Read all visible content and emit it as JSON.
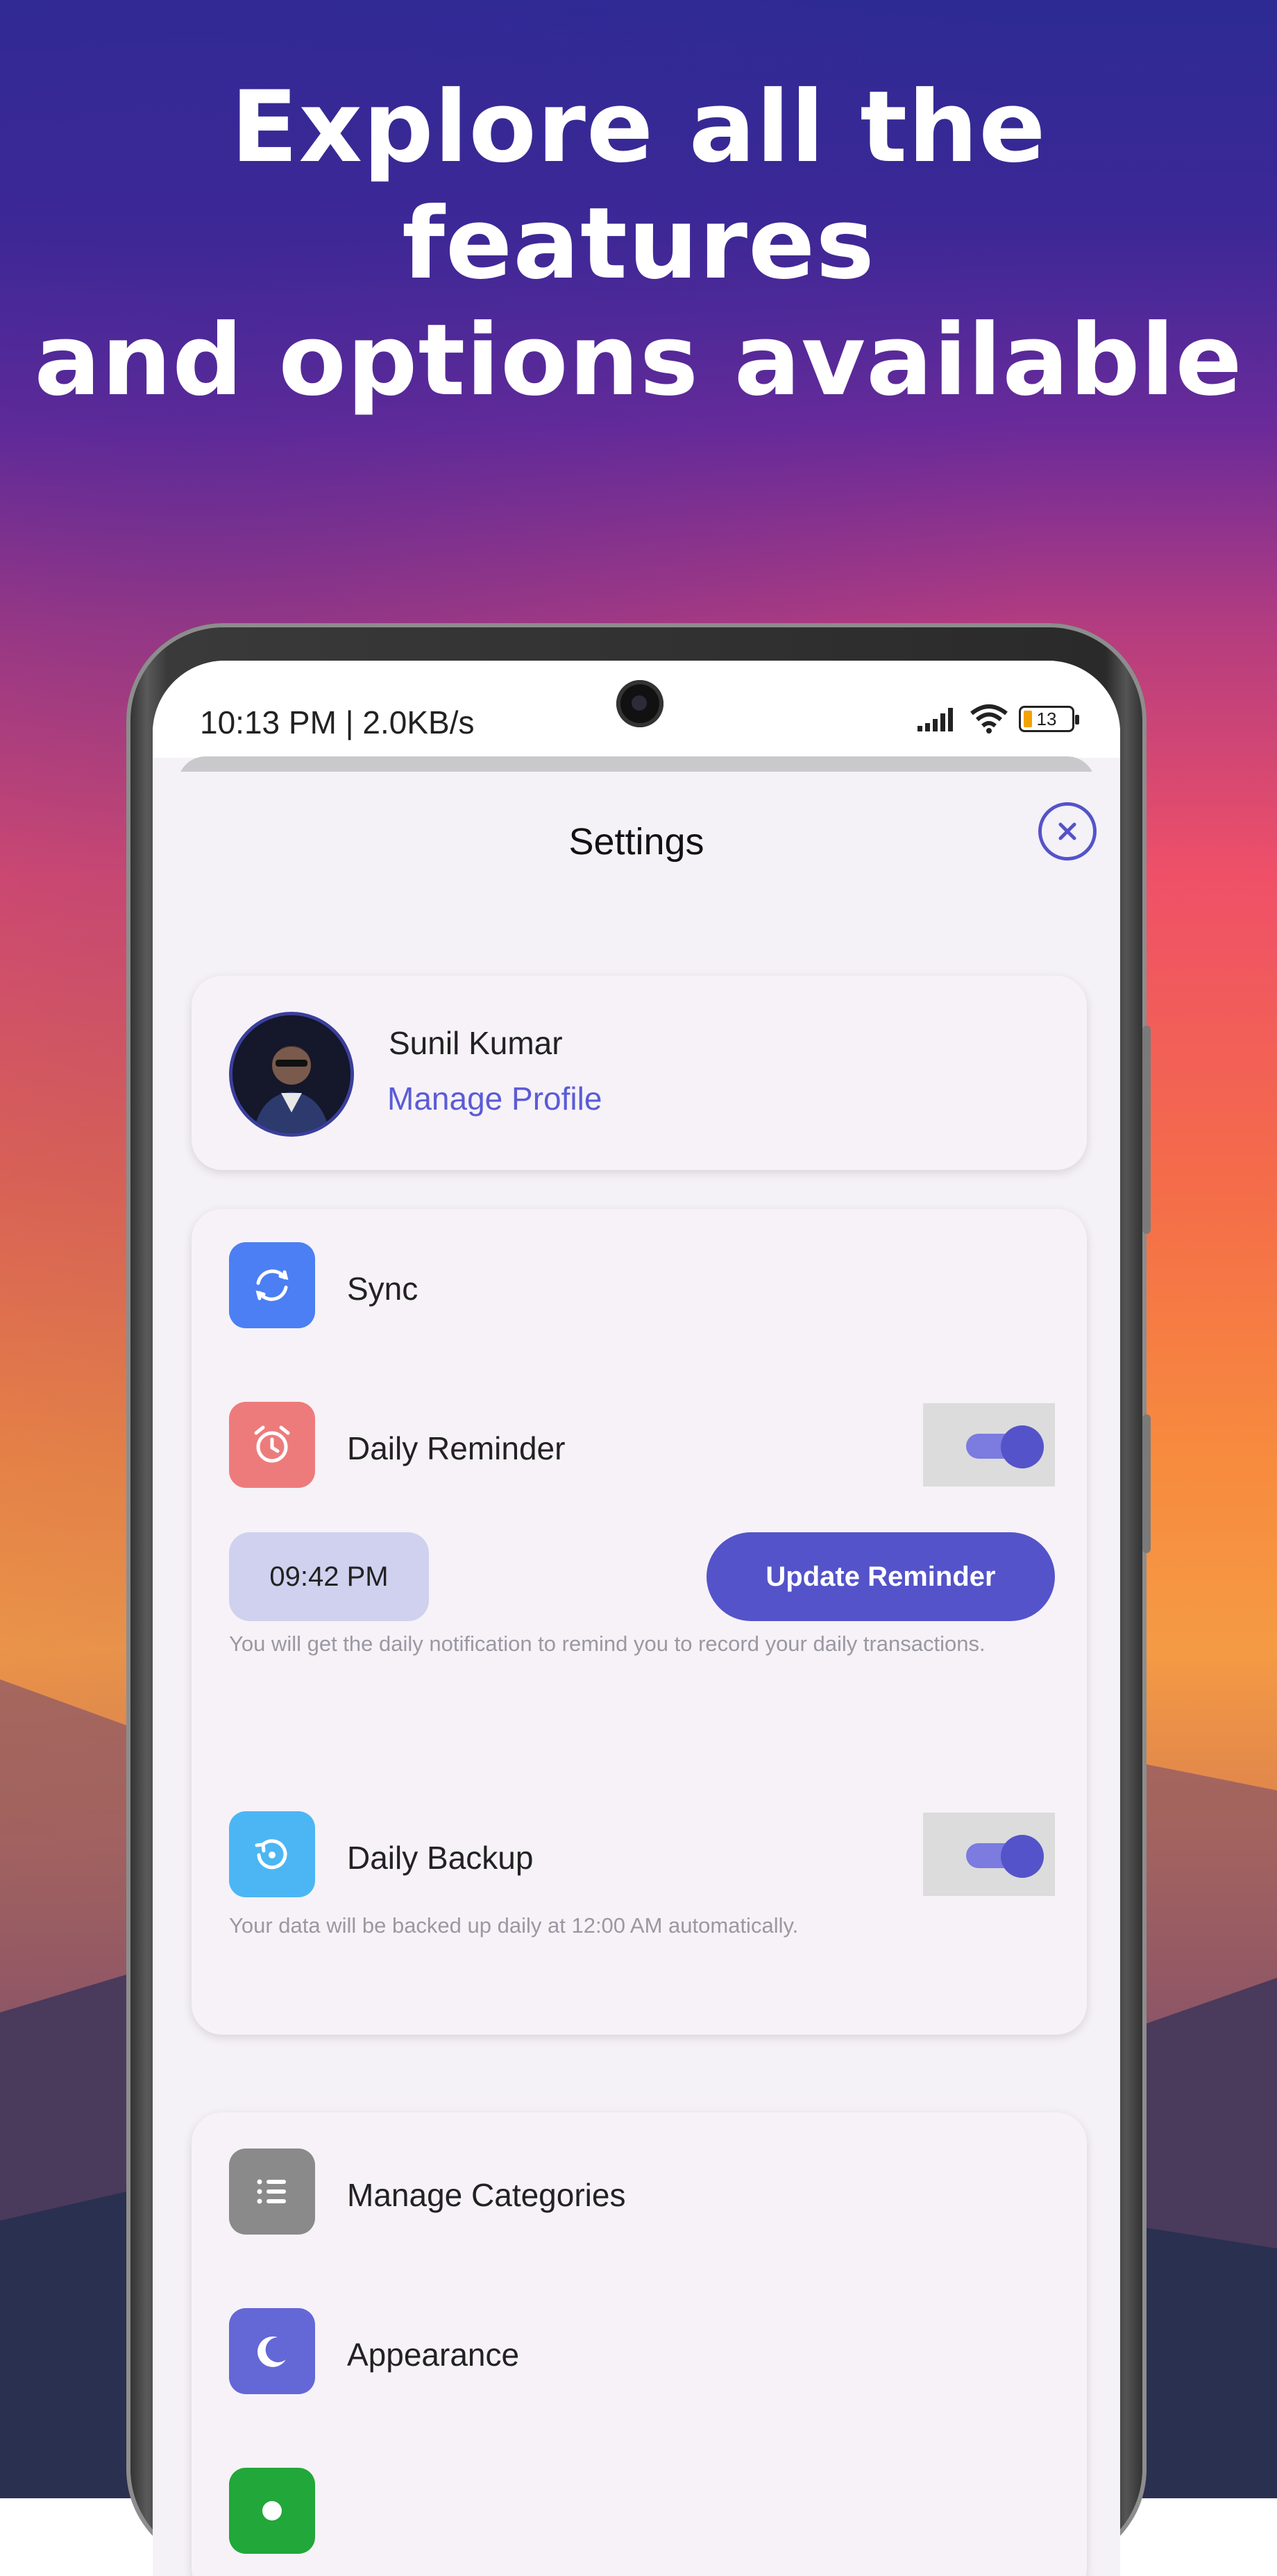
{
  "headline": {
    "line1": "Explore all the features",
    "line2": "and options available"
  },
  "status_bar": {
    "time_speed": "10:13 PM | 2.0KB/s",
    "battery": "13"
  },
  "header": {
    "title": "Settings"
  },
  "profile": {
    "name": "Sunil Kumar",
    "link": "Manage Profile"
  },
  "settings": {
    "sync_label": "Sync",
    "daily_reminder_label": "Daily Reminder",
    "daily_reminder_enabled": true,
    "reminder_time": "09:42 PM",
    "update_reminder_label": "Update Reminder",
    "reminder_note": "You will get the daily notification to remind you to record your daily transactions.",
    "daily_backup_label": "Daily Backup",
    "daily_backup_enabled": true,
    "backup_note": "Your data will be backed up daily at 12:00 AM automatically."
  },
  "more": {
    "manage_categories_label": "Manage Categories",
    "appearance_label": "Appearance"
  },
  "colors": {
    "accent": "#5453c9",
    "sync_icon": "#4b7ff3",
    "reminder_icon": "#ee7b7b",
    "backup_icon": "#4cb6f4",
    "categories_icon": "#8a8a8a",
    "appearance_icon": "#6467d6",
    "partial_icon": "#22a73a"
  },
  "icons": [
    "sync-icon",
    "alarm-clock-icon",
    "backup-restore-icon",
    "list-icon",
    "moon-icon",
    "close-icon",
    "signal-icon",
    "wifi-icon",
    "battery-icon"
  ]
}
